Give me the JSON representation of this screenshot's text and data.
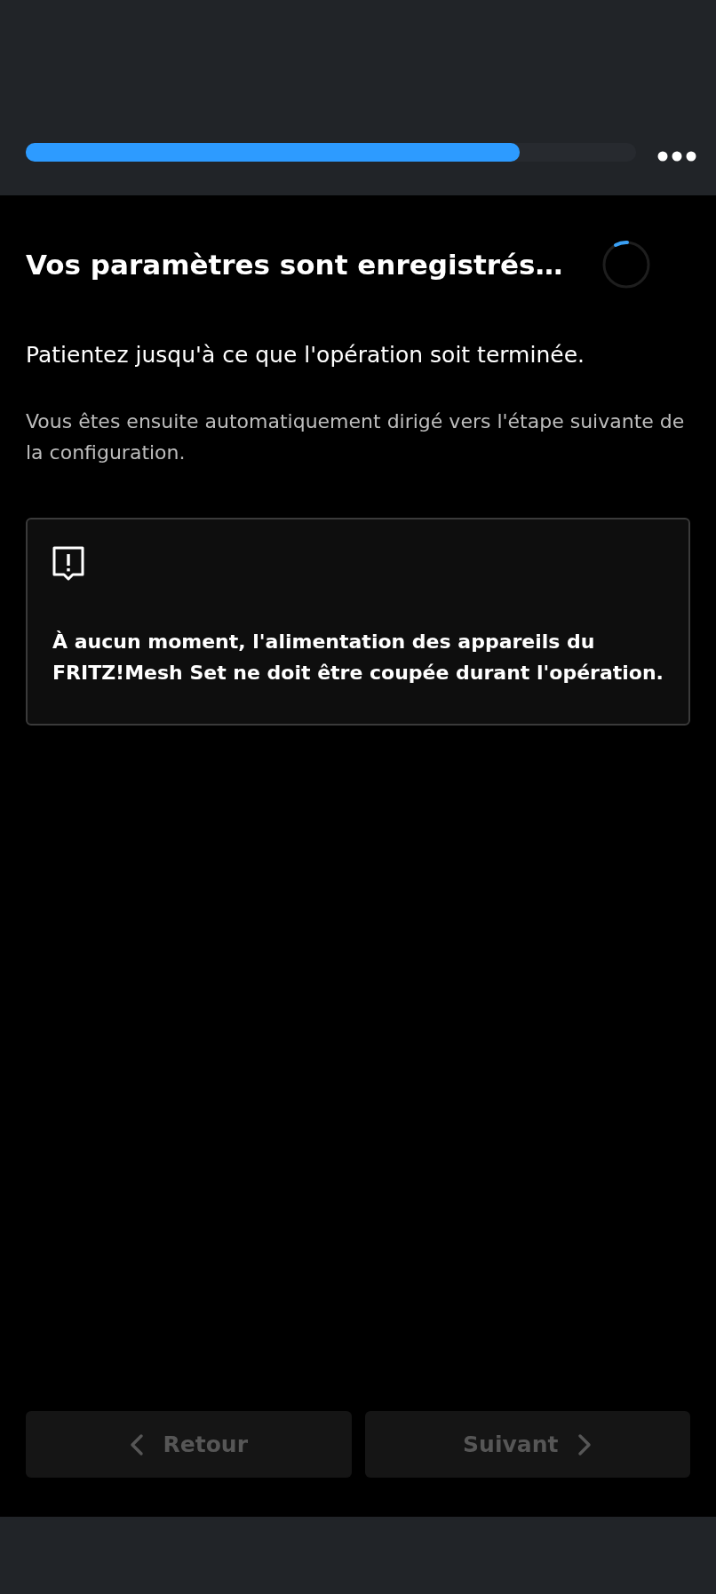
{
  "progress": {
    "level": 0.81
  },
  "title": "Vos paramètres sont enregistrés…",
  "message": "Patientez jusqu'à ce que l'opération soit terminée.",
  "hint": "Vous êtes ensuite automatiquement dirigé vers l'étape suivante de la configuration.",
  "notice": {
    "text": "À aucun moment, l'alimentation des appareils du FRITZ!Mesh Set ne doit être coupée durant l'opération."
  },
  "buttons": [
    {
      "label": "Retour",
      "kind": "back",
      "disabled": true
    },
    {
      "label": "Suivant",
      "kind": "next",
      "disabled": true
    }
  ]
}
